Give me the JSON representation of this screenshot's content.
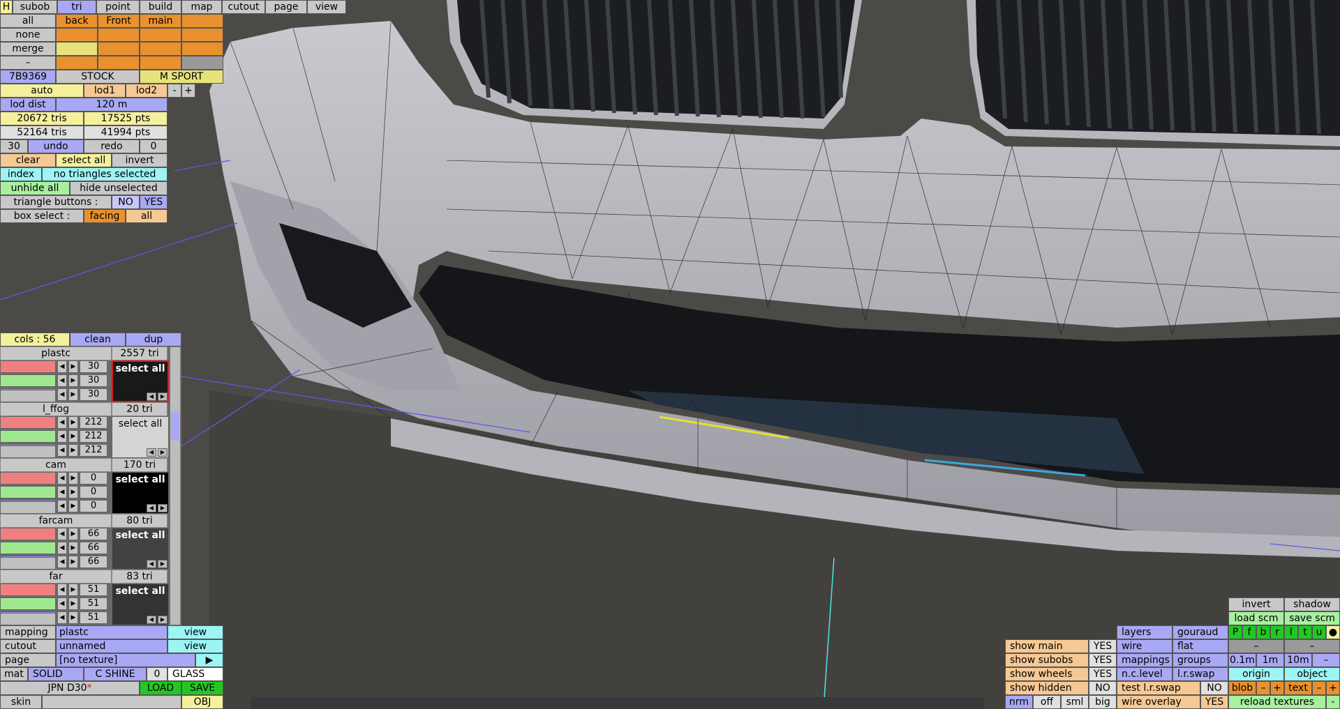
{
  "colors": {
    "accent": "#a8a8f4",
    "orange": "#e8912e",
    "yellow": "#f4f09c",
    "cyan": "#9cf4f4",
    "green": "#22c822"
  },
  "top_tabs": [
    "H",
    "subob",
    "tri",
    "point",
    "build",
    "map",
    "cutout",
    "page",
    "view"
  ],
  "subob_grid": {
    "row_labels": [
      "all",
      "none",
      "merge",
      "–"
    ],
    "header": [
      "back",
      "Front",
      "main"
    ]
  },
  "variant_row": {
    "code": "7B9369",
    "stock": "STOCK",
    "msport": "M SPORT"
  },
  "lod_row": {
    "auto": "auto",
    "lod1": "lod1",
    "lod2": "lod2",
    "minus": "-",
    "plus": "+"
  },
  "lod_dist": {
    "label": "lod dist",
    "value": "120 m"
  },
  "stats": {
    "tris1": "20672 tris",
    "pts1": "17525 pts",
    "tris2": "52164 tris",
    "pts2": "41994 pts"
  },
  "undo_row": {
    "count": "30",
    "undo": "undo",
    "redo": "redo",
    "redo_count": "0"
  },
  "select_row": {
    "clear": "clear",
    "select_all": "select all",
    "invert": "invert"
  },
  "index_row": {
    "index": "index",
    "status": "no triangles selected"
  },
  "unhide_row": {
    "unhide": "unhide all",
    "hide": "hide unselected"
  },
  "tri_buttons": {
    "label": "triangle buttons :",
    "no": "NO",
    "yes": "YES"
  },
  "box_select": {
    "label": "box select :",
    "facing": "facing",
    "all": "all"
  },
  "cols_panel": {
    "header": {
      "cols": "cols : 56",
      "clean": "clean",
      "dup": "dup"
    },
    "materials": [
      {
        "name": "plastc",
        "tris": "2557 tri",
        "r": "30",
        "g": "30",
        "b": "30",
        "select": "select all",
        "bg": "#191919",
        "selected": true
      },
      {
        "name": "l_ffog",
        "tris": "20 tri",
        "r": "212",
        "g": "212",
        "b": "212",
        "select": "select all",
        "bg": "#d4d4d4",
        "selected": false
      },
      {
        "name": "cam",
        "tris": "170 tri",
        "r": "0",
        "g": "0",
        "b": "0",
        "select": "select all",
        "bg": "#000000",
        "selected": false
      },
      {
        "name": "farcam",
        "tris": "80 tri",
        "r": "66",
        "g": "66",
        "b": "66",
        "select": "select all",
        "bg": "#424242",
        "selected": false
      },
      {
        "name": "far",
        "tris": "83 tri",
        "r": "51",
        "g": "51",
        "b": "51",
        "select": "select all",
        "bg": "#333333",
        "selected": false
      }
    ]
  },
  "bottom_left": {
    "mapping": {
      "label": "mapping",
      "value": "plastc",
      "view": "view"
    },
    "cutout": {
      "label": "cutout",
      "value": "unnamed",
      "view": "view"
    },
    "page": {
      "label": "page",
      "value": "[no texture]",
      "arrow": "▶"
    },
    "mat": {
      "label": "mat",
      "solid": "SOLID",
      "cshine": "C SHINE",
      "zero": "0",
      "glass": "GLASS"
    },
    "file": {
      "name": "JPN D30",
      "star": "*",
      "load": "LOAD",
      "save": "SAVE"
    },
    "skin": {
      "label": "skin",
      "obj": "OBJ"
    }
  },
  "right_panel": {
    "show_main": "show main",
    "show_subobs": "show subobs",
    "show_wheels": "show wheels",
    "show_hidden": "show hidden",
    "yes": "YES",
    "no": "NO",
    "layers": "layers",
    "gouraud": "gouraud",
    "wire": "wire",
    "flat": "flat",
    "mappings": "mappings",
    "groups": "groups",
    "nc_level": "n.c.level",
    "lr_swap": "l.r.swap",
    "test_lr_swap": "test l.r.swap",
    "wire_overlay": "wire overlay",
    "nrm": "nrm",
    "off": "off",
    "sml": "sml",
    "big": "big",
    "invert": "invert",
    "shadow": "shadow",
    "load_scm": "load scm",
    "save_scm": "save scm",
    "pfbrltu": [
      "P",
      "f",
      "b",
      "r",
      "l",
      "t",
      "u",
      "●"
    ],
    "dash": "–",
    "dist": [
      "0.1m",
      "1m",
      "10m",
      "–"
    ],
    "origin": "origin",
    "object": "object",
    "blob": "blob",
    "text": "text",
    "minus": "–",
    "plus": "+",
    "reload": "reload textures",
    "dash2": "-"
  }
}
